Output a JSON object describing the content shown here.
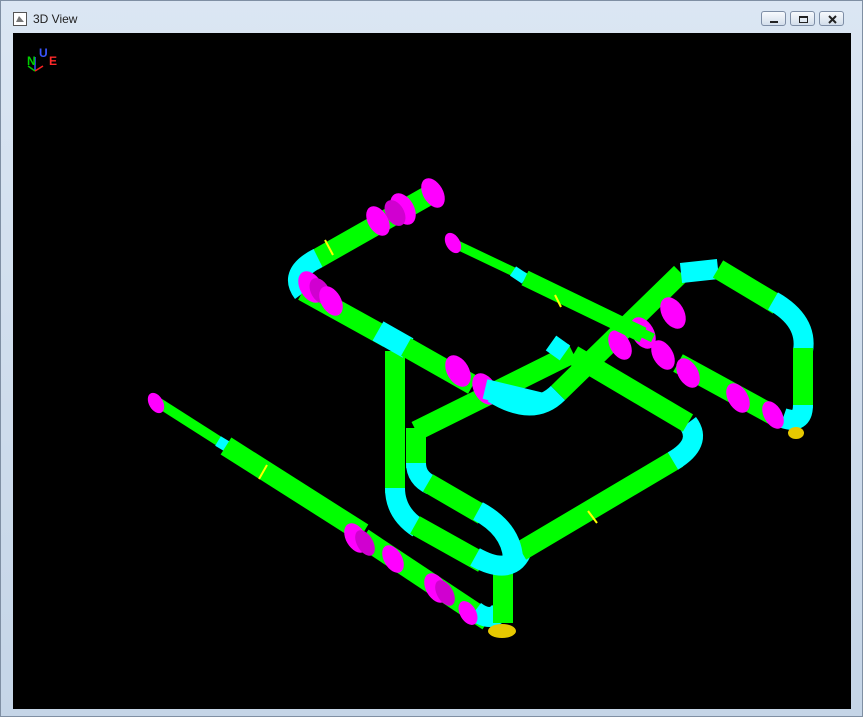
{
  "window": {
    "title": "3D View",
    "controls": [
      "minimize",
      "restore",
      "close"
    ]
  },
  "compass": {
    "north": "N",
    "up": "U",
    "east": "E"
  },
  "colors": {
    "background": "#000000",
    "pipe": "#00ff00",
    "elbow": "#00ffff",
    "flange_valve": "#ff00ff",
    "weld": "#ffff00",
    "support": "#e6c800"
  },
  "icons": [
    "window-app-icon",
    "minimize-icon",
    "restore-icon",
    "close-icon",
    "compass-axes-icon"
  ]
}
